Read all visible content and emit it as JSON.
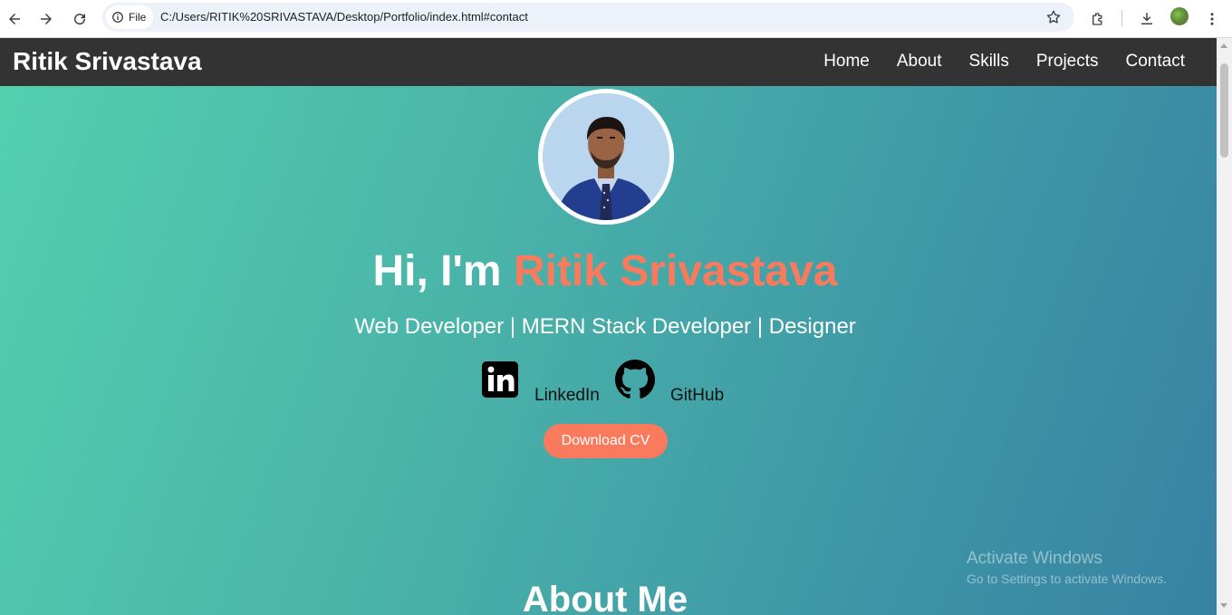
{
  "browser": {
    "site_chip_label": "File",
    "url": "C:/Users/RITIK%20SRIVASTAVA/Desktop/Portfolio/index.html#contact",
    "icons": [
      "back-icon",
      "forward-icon",
      "reload-icon",
      "info-icon",
      "star-icon",
      "extensions-icon",
      "download-icon",
      "profile-avatar",
      "menu-icon"
    ]
  },
  "navbar": {
    "brand": "Ritik Srivastava",
    "links": [
      {
        "label": "Home"
      },
      {
        "label": "About"
      },
      {
        "label": "Skills"
      },
      {
        "label": "Projects"
      },
      {
        "label": "Contact"
      }
    ]
  },
  "hero": {
    "greeting": "Hi, I'm ",
    "name": "Ritik Srivastava",
    "subtitle": "Web Developer | MERN Stack Developer | Designer",
    "social": [
      {
        "icon": "linkedin-icon",
        "label": "LinkedIn"
      },
      {
        "icon": "github-icon",
        "label": "GitHub"
      }
    ],
    "cv_button": "Download CV"
  },
  "about": {
    "heading": "About Me"
  },
  "watermark": {
    "line1": "Activate Windows",
    "line2": "Go to Settings to activate Windows."
  },
  "colors": {
    "navbar_bg": "#333333",
    "accent": "#fa7a5e",
    "gradient_start": "#52d1ae",
    "gradient_end": "#3882a3"
  }
}
